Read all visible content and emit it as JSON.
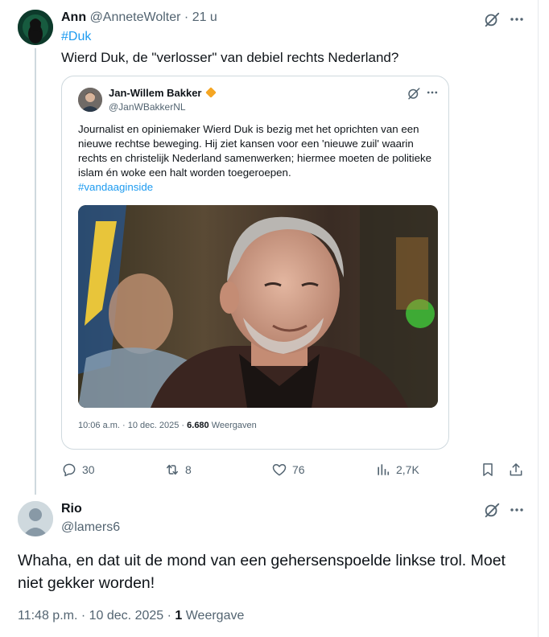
{
  "tweet": {
    "author_name": "Ann",
    "author_handle": "@AnneteWolter",
    "separator": "·",
    "time": "21 u",
    "hashtag": "#Duk",
    "text": "Wierd Duk, de \"verlosser\" van debiel rechts Nederland?",
    "quote": {
      "author_name": "Jan-Willem Bakker",
      "author_handle": "@JanWBakkerNL",
      "text": "Journalist en opiniemaker Wierd Duk is bezig met het oprichten van een nieuwe rechtse beweging. Hij ziet kansen voor een 'nieuwe zuil' waarin rechts en christelijk Nederland samenwerken; hiermee moeten de politieke islam én woke een halt worden toegeroepen.",
      "hashtag": "#vandaaginside",
      "time": "10:06 a.m. · 10 dec. 2025 · ",
      "views_count": "6.680",
      "views_label": " Weergaven"
    },
    "actions": {
      "replies": "30",
      "reposts": "8",
      "likes": "76",
      "views": "2,7K"
    }
  },
  "reply": {
    "author_name": "Rio",
    "author_handle": "@lamers6",
    "text": "Whaha, en dat uit de mond van een gehersenspoelde linkse trol. Moet niet gekker worden!",
    "time": "11:48 p.m. · 10 dec. 2025 · ",
    "views_count": "1",
    "views_label": " Weergave"
  },
  "icons": [
    "grok-icon",
    "more-icon",
    "reply-icon",
    "repost-icon",
    "like-icon",
    "views-icon",
    "bookmark-icon",
    "share-icon",
    "verified-badge-icon"
  ],
  "colors": {
    "link": "#1d9bf0",
    "secondary": "#536471",
    "border": "#cfd9de",
    "badge": "#f5a623"
  }
}
